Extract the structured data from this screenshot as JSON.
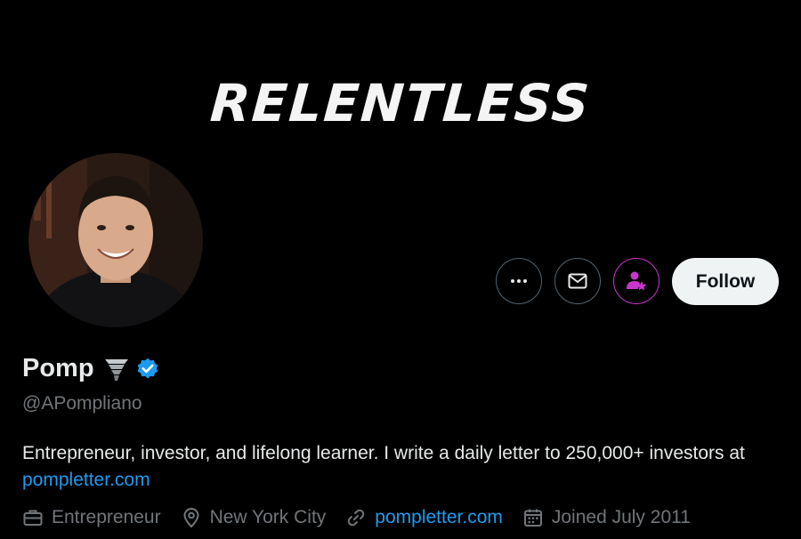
{
  "banner": {
    "text": "RELENTLESS"
  },
  "actions": {
    "follow_label": "Follow"
  },
  "profile": {
    "display_name": "Pomp",
    "handle": "@APompliano",
    "bio_text": "Entrepreneur, investor, and lifelong learner. I write a daily letter to 250,000+ investors at ",
    "bio_link": "pompletter.com"
  },
  "meta": {
    "profession": "Entrepreneur",
    "location": "New York City",
    "website": "pompletter.com",
    "joined": "Joined July 2011"
  },
  "colors": {
    "accent": "#1d9bf0",
    "subscribe_accent": "#c936cc",
    "muted": "#71767b"
  },
  "icons": [
    "more-icon",
    "mail-icon",
    "subscribe-icon",
    "tornado-icon",
    "verified-icon",
    "briefcase-icon",
    "location-icon",
    "link-icon",
    "calendar-icon"
  ]
}
